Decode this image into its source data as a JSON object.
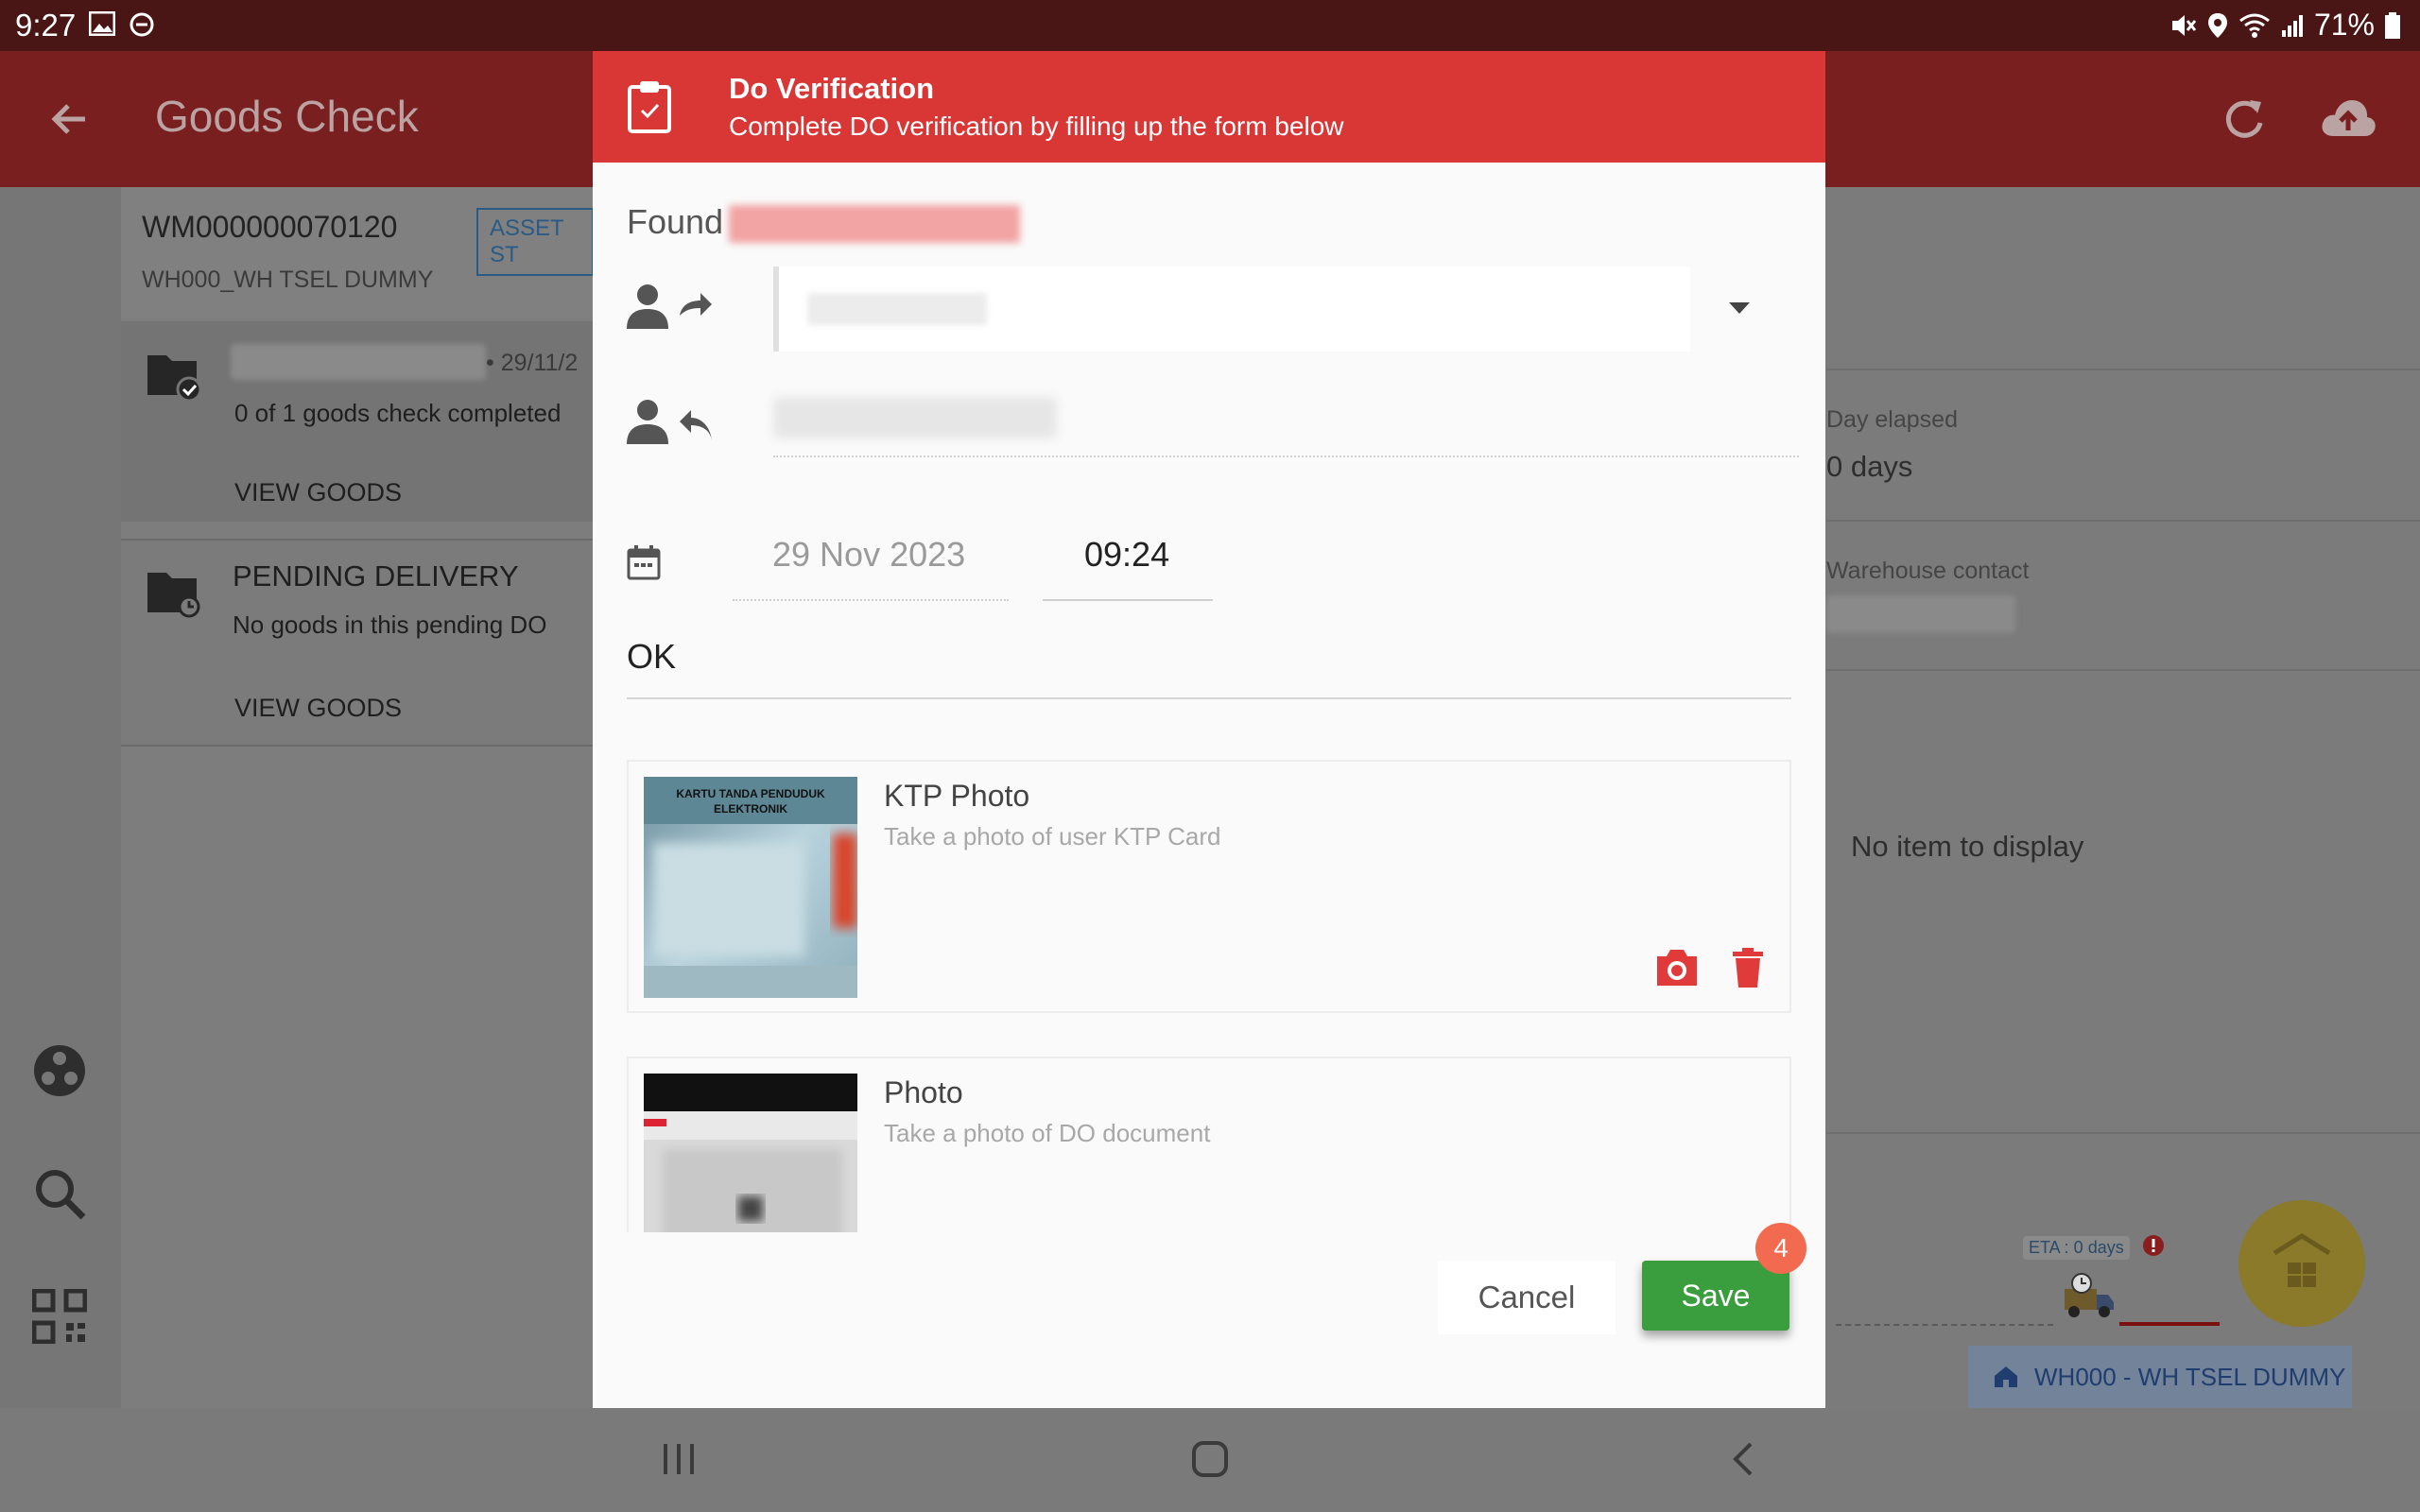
{
  "status_bar": {
    "time": "9:27",
    "battery": "71%"
  },
  "app_bar": {
    "title": "Goods Check"
  },
  "left_panel": {
    "wm_number": "WM000000070120",
    "asset_badge": "ASSET ST",
    "warehouse": "WH000_WH TSEL DUMMY",
    "card1": {
      "date_suffix": "• 29/11/2",
      "progress_text": "0 of  1 goods check completed",
      "view_label": "VIEW GOODS"
    },
    "card2": {
      "title": "PENDING DELIVERY",
      "subtitle": "No goods in this pending DO",
      "view_label": "VIEW GOODS"
    }
  },
  "right_panel": {
    "day_elapsed_label": "Day elapsed",
    "day_elapsed_value": "0 days",
    "warehouse_contact_label": "Warehouse contact",
    "empty_text": "No item to display",
    "eta_label": "ETA : 0 days",
    "warehouse_chip": "WH000 - WH TSEL DUMMY"
  },
  "dialog": {
    "title": "Do Verification",
    "subtitle": "Complete DO verification by filling up the form below",
    "found_label": "Found",
    "date": "29 Nov 2023",
    "time": "09:24",
    "note": "OK",
    "ktp": {
      "title": "KTP Photo",
      "subtitle": "Take a photo of user KTP Card",
      "card_text": "KARTU TANDA PENDUDUK\nELEKTRONIK"
    },
    "doc": {
      "title": "Photo",
      "subtitle": "Take a photo of DO document"
    },
    "cancel_label": "Cancel",
    "save_label": "Save",
    "badge_count": "4"
  },
  "colors": {
    "header_red": "#d93636",
    "save_green": "#3a9d3e",
    "badge": "#f26a4f",
    "status_bar": "#4a1515"
  }
}
